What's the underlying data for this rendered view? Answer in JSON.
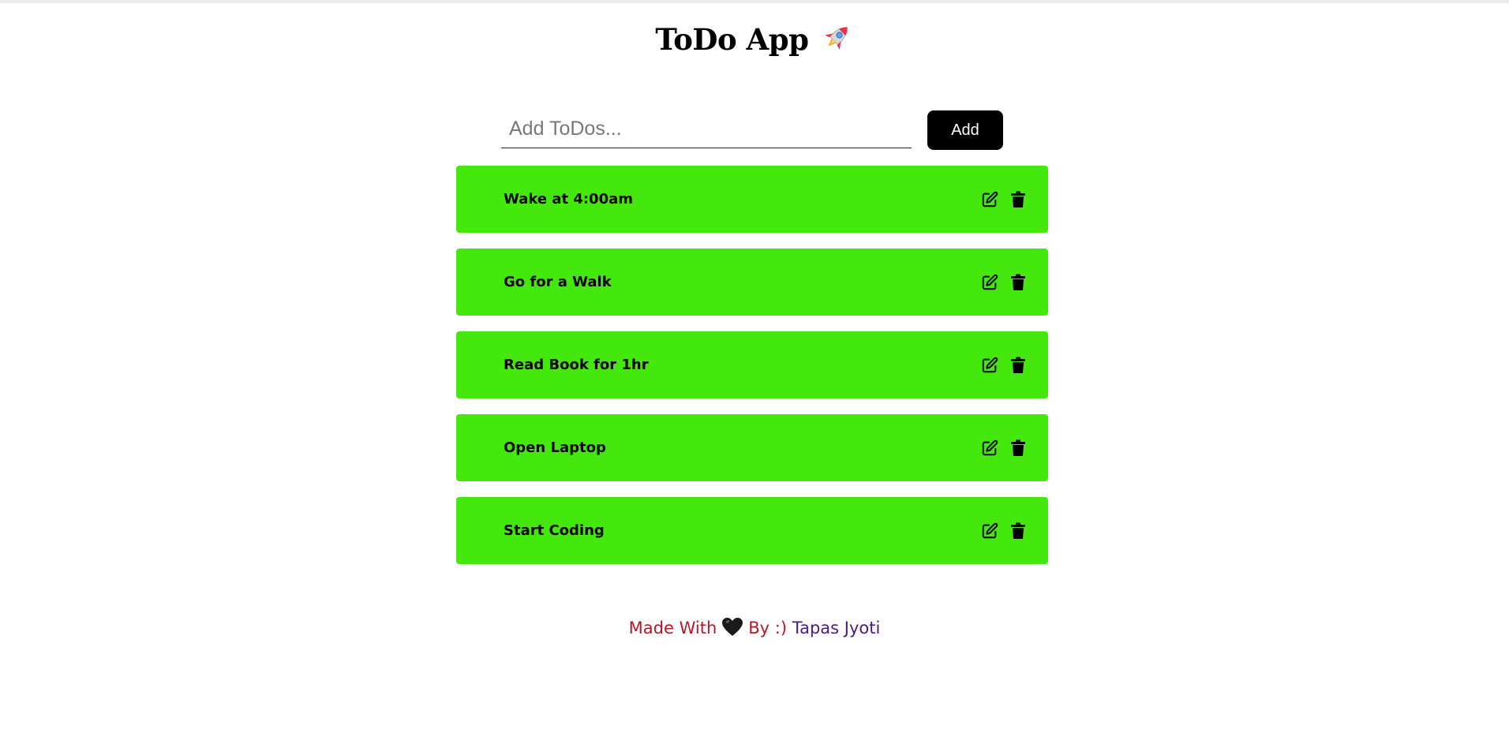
{
  "header": {
    "title": "ToDo App",
    "emoji_icon": "rocket-icon"
  },
  "input": {
    "placeholder": "Add ToDos...",
    "value": "",
    "add_label": "Add"
  },
  "todos": [
    {
      "text": "Wake at 4:00am"
    },
    {
      "text": "Go for a Walk"
    },
    {
      "text": "Read Book for 1hr"
    },
    {
      "text": "Open Laptop"
    },
    {
      "text": "Start Coding"
    }
  ],
  "footer": {
    "made_with": "Made With",
    "heart_icon": "black-heart-icon",
    "by": "By :)",
    "author": "Tapas Jyoti"
  },
  "colors": {
    "item_background": "#45e80d",
    "button_background": "#000000",
    "footer_made": "#b3192b",
    "footer_author": "#4b1a87"
  }
}
